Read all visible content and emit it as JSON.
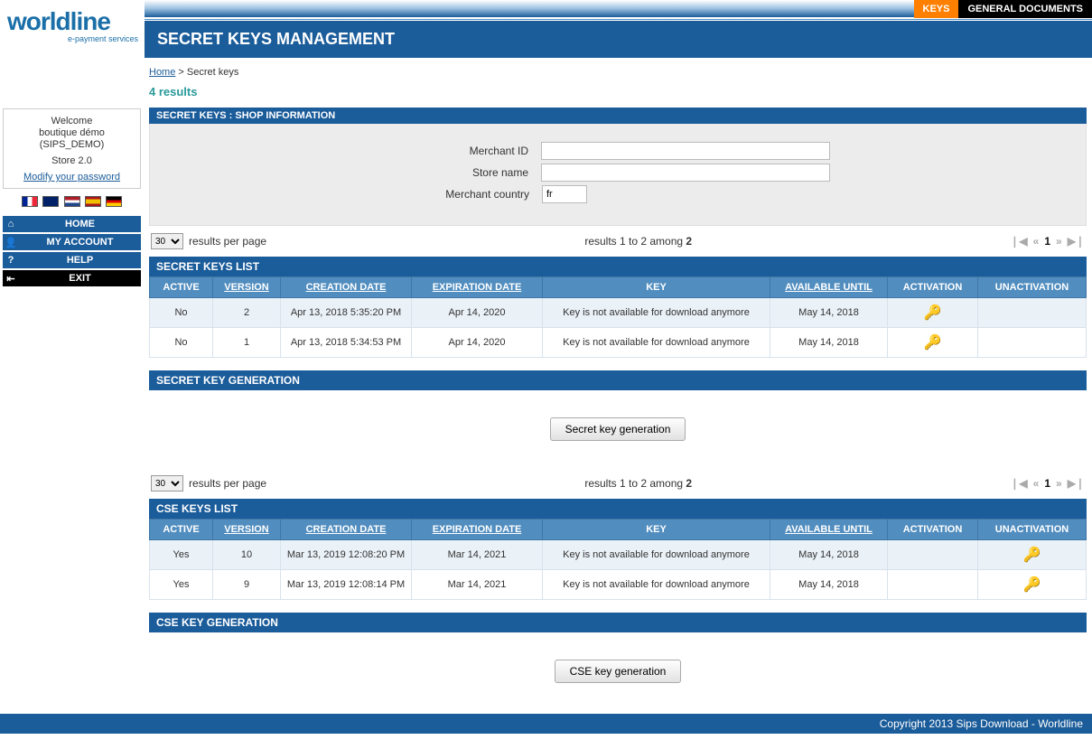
{
  "tabs": {
    "keys": "KEYS",
    "docs": "GENERAL DOCUMENTS"
  },
  "page_title": "SECRET KEYS MANAGEMENT",
  "logo": {
    "text": "worldline",
    "sub": "e-payment services"
  },
  "breadcrumb": {
    "home": "Home",
    "current": "Secret keys"
  },
  "welcome": {
    "l1": "Welcome",
    "l2": "boutique démo",
    "l3": "(SIPS_DEMO)",
    "store": "Store 2.0",
    "modify": "Modify your password"
  },
  "nav": {
    "home": "HOME",
    "account": "MY ACCOUNT",
    "help": "HELP",
    "exit": "EXIT"
  },
  "results_count": "4 results",
  "shop_info": {
    "title": "SECRET KEYS  :  SHOP INFORMATION",
    "merchant_id_label": "Merchant ID",
    "merchant_id_value": "",
    "store_name_label": "Store name",
    "store_name_value": "",
    "country_label": "Merchant country",
    "country_value": "fr"
  },
  "pager1": {
    "page_size": "30",
    "rpp": "results per page",
    "center_prefix": "results 1 to 2 among ",
    "center_bold": "2",
    "current": "1"
  },
  "secret_keys": {
    "title": "SECRET KEYS LIST",
    "headers": {
      "active": "ACTIVE",
      "version": "VERSION",
      "creation": "CREATION DATE",
      "expiration": "EXPIRATION DATE",
      "key": "KEY",
      "available": "AVAILABLE UNTIL",
      "activation": "ACTIVATION",
      "unactivation": "UNACTIVATION"
    },
    "rows": [
      {
        "active": "No",
        "version": "2",
        "creation": "Apr 13, 2018 5:35:20 PM",
        "expiration": "Apr 14, 2020",
        "key": "Key is not available for download anymore",
        "available": "May 14, 2018"
      },
      {
        "active": "No",
        "version": "1",
        "creation": "Apr 13, 2018 5:34:53 PM",
        "expiration": "Apr 14, 2020",
        "key": "Key is not available for download anymore",
        "available": "May 14, 2018"
      }
    ]
  },
  "secret_gen": {
    "title": "SECRET KEY GENERATION",
    "button": "Secret key generation"
  },
  "pager2": {
    "page_size": "30",
    "rpp": "results per page",
    "center_prefix": "results 1 to 2 among ",
    "center_bold": "2",
    "current": "1"
  },
  "cse_keys": {
    "title": "CSE KEYS LIST",
    "headers": {
      "active": "ACTIVE",
      "version": "VERSION",
      "creation": "CREATION DATE",
      "expiration": "EXPIRATION DATE",
      "key": "KEY",
      "available": "AVAILABLE UNTIL",
      "activation": "ACTIVATION",
      "unactivation": "UNACTIVATION"
    },
    "rows": [
      {
        "active": "Yes",
        "version": "10",
        "creation": "Mar 13, 2019 12:08:20 PM",
        "expiration": "Mar 14, 2021",
        "key": "Key is not available for download anymore",
        "available": "May 14, 2018"
      },
      {
        "active": "Yes",
        "version": "9",
        "creation": "Mar 13, 2019 12:08:14 PM",
        "expiration": "Mar 14, 2021",
        "key": "Key is not available for download anymore",
        "available": "May 14, 2018"
      }
    ]
  },
  "cse_gen": {
    "title": "CSE KEY GENERATION",
    "button": "CSE key generation"
  },
  "footer": "Copyright 2013 Sips Download - Worldline",
  "glyphs": {
    "first": "❘◀",
    "prev": "◀",
    "next": "▶",
    "last": "▶❘",
    "first2": "⏮",
    "prev2": "«",
    "next2": "»",
    "last2": "⏭"
  }
}
